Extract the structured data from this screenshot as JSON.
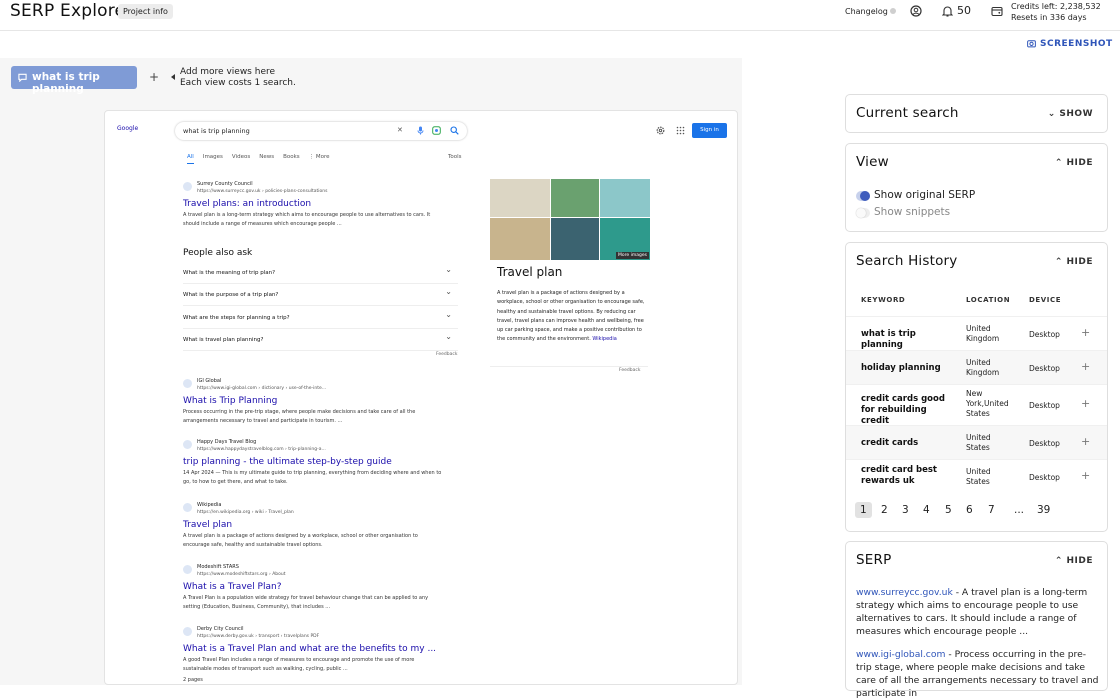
{
  "header": {
    "app_title": "SERP Explorer",
    "project_info": "Project info",
    "changelog": "Changelog",
    "notifications_count": "50",
    "credits_line": "Credits left: 2,238,532",
    "resets_line": "Resets in 336 days",
    "screenshot_label": "SCREENSHOT"
  },
  "views": {
    "active_tab": "what is trip planning",
    "hint_line1": "Add more views here",
    "hint_line2": "Each view costs 1 search."
  },
  "serp_preview": {
    "google_logo": "Google",
    "query": "what is trip planning",
    "sign_in": "Sign in",
    "tabs": [
      "All",
      "Images",
      "Videos",
      "News",
      "Books",
      "⋮ More"
    ],
    "tools": "Tools",
    "results": [
      {
        "site": "Surrey County Council",
        "url": "https://www.surreycc.gov.uk › policies-plans-consultations",
        "title": "Travel plans: an introduction",
        "snippet": "A travel plan is a long-term strategy which aims to encourage people to use alternatives to cars. It should include a range of measures which encourage people ..."
      },
      {
        "site": "IGI Global",
        "url": "https://www.igi-global.com › dictionary › use-of-the-inte...",
        "title": "What is Trip Planning",
        "snippet": "Process occurring in the pre-trip stage, where people make decisions and take care of all the arrangements necessary to travel and participate in tourism. ..."
      },
      {
        "site": "Happy Days Travel Blog",
        "url": "https://www.happydaystravelblog.com › trip-planning-a...",
        "title": "trip planning - the ultimate step-by-step guide",
        "snippet": "14 Apr 2024 — This is my ultimate guide to trip planning, everything from deciding where and when to go, to how to get there, and what to take."
      },
      {
        "site": "Wikipedia",
        "url": "https://en.wikipedia.org › wiki › Travel_plan",
        "title": "Travel plan",
        "snippet": "A travel plan is a package of actions designed by a workplace, school or other organisation to encourage safe, healthy and sustainable travel options."
      },
      {
        "site": "Modeshift STARS",
        "url": "https://www.modeshiftstars.org › About",
        "title": "What is a Travel Plan?",
        "snippet": "A Travel Plan is a population wide strategy for travel behaviour change that can be applied to any setting (Education, Business, Community), that includes ..."
      },
      {
        "site": "Derby City Council",
        "url": "https://www.derby.gov.uk › transport › travelplans  PDF",
        "title": "What is a Travel Plan and what are the benefits to my ...",
        "snippet": "A good Travel Plan includes a range of measures to encourage and promote the use of more sustainable modes of transport such as walking, cycling, public ...",
        "extra": "2 pages"
      }
    ],
    "paa_title": "People also ask",
    "paa": [
      "What is the meaning of trip plan?",
      "What is the purpose of a trip plan?",
      "What are the steps for planning a trip?",
      "What is travel plan planning?"
    ],
    "feedback": "Feedback",
    "kp": {
      "title": "Travel plan",
      "more_images": "More images",
      "description": "A travel plan is a package of actions designed by a workplace, school or other organisation to encourage safe, healthy and sustainable travel options. By reducing car travel, travel plans can improve health and wellbeing, free up car parking space, and make a positive contribution to the community and the environment.",
      "source": "Wikipedia"
    }
  },
  "panels": {
    "current_search": {
      "title": "Current search",
      "toggle": "SHOW"
    },
    "view": {
      "title": "View",
      "toggle": "HIDE",
      "options": [
        "Show original SERP",
        "Show snippets"
      ]
    },
    "history": {
      "title": "Search History",
      "toggle": "HIDE",
      "columns": [
        "KEYWORD",
        "LOCATION",
        "DEVICE"
      ],
      "rows": [
        {
          "keyword": "what is trip planning",
          "location": "United Kingdom",
          "device": "Desktop"
        },
        {
          "keyword": "holiday planning",
          "location": "United Kingdom",
          "device": "Desktop"
        },
        {
          "keyword": "credit cards good for rebuilding credit",
          "location": "New York,United States",
          "device": "Desktop"
        },
        {
          "keyword": "credit cards",
          "location": "United States",
          "device": "Desktop"
        },
        {
          "keyword": "credit card best rewards uk",
          "location": "United States",
          "device": "Desktop"
        }
      ],
      "pages": [
        "1",
        "2",
        "3",
        "4",
        "5",
        "6",
        "7",
        "...",
        "39"
      ]
    },
    "serp": {
      "title": "SERP",
      "toggle": "HIDE",
      "snippets": [
        {
          "domain": "www.surreycc.gov.uk",
          "text": " - A travel plan is a long-term strategy which aims to encourage people to use alternatives to cars. It should include a range of measures which encourage people ..."
        },
        {
          "domain": "www.igi-global.com",
          "text": " - Process occurring in the pre-trip stage, where people make decisions and take care of all the arrangements necessary to travel and participate in"
        }
      ]
    }
  }
}
